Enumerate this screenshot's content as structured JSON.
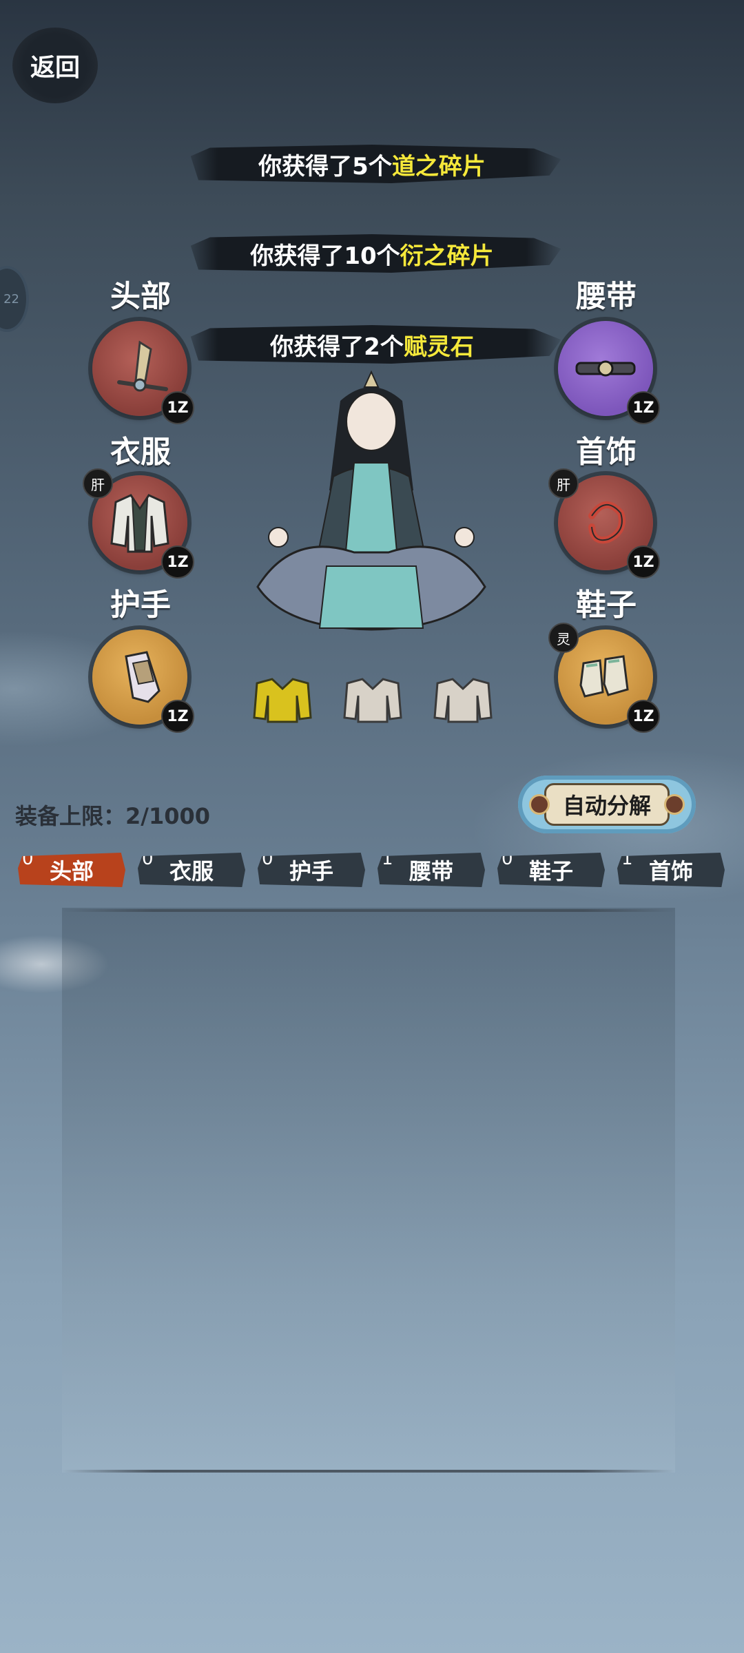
{
  "back_label": "返回",
  "side_badge": "22",
  "toasts": [
    {
      "prefix": "你获得了5个",
      "item": "道之碎片"
    },
    {
      "prefix": "你获得了10个",
      "item": "衍之碎片"
    },
    {
      "prefix": "你获得了2个",
      "item": "赋灵石"
    }
  ],
  "slots": {
    "head": {
      "label": "头部",
      "level": "1Z"
    },
    "belt": {
      "label": "腰带",
      "level": "1Z"
    },
    "clothes": {
      "label": "衣服",
      "level": "1Z",
      "tag": "肝"
    },
    "jewelry": {
      "label": "首饰",
      "level": "1Z",
      "tag": "肝"
    },
    "gloves": {
      "label": "护手",
      "level": "1Z"
    },
    "shoes": {
      "label": "鞋子",
      "level": "1Z",
      "tag": "灵"
    }
  },
  "limit_text": "装备上限：2/1000",
  "auto_button": "自动分解",
  "tabs": [
    {
      "label": "头部",
      "count": "0"
    },
    {
      "label": "衣服",
      "count": "0"
    },
    {
      "label": "护手",
      "count": "0"
    },
    {
      "label": "腰带",
      "count": "1"
    },
    {
      "label": "鞋子",
      "count": "0"
    },
    {
      "label": "首饰",
      "count": "1"
    }
  ],
  "colors": {
    "highlight": "#f5e83a",
    "active_tab": "#b8421c"
  }
}
